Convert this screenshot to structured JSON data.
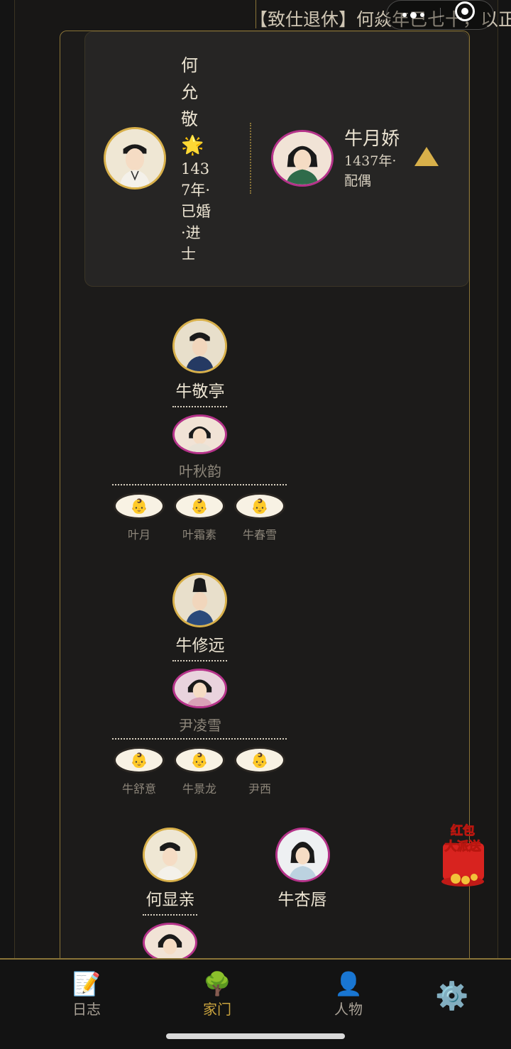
{
  "topbar": {
    "ticker_text": "【致仕退休】何焱年已七十，以正"
  },
  "head_card": {
    "name": "何允敬",
    "star_icon": "star-icon",
    "meta": "1437年·已婚·进士",
    "spouse": {
      "name": "牛月娇",
      "meta": "1437年·配偶"
    },
    "collapse_icon": "triangle-up-icon"
  },
  "branches": [
    {
      "name": "牛敬亭",
      "spouse": "叶秋韵",
      "children": [
        "叶月",
        "叶霜素",
        "牛春雪"
      ]
    },
    {
      "name": "牛修远",
      "spouse": "尹凌雪",
      "children": [
        "牛舒意",
        "牛景龙",
        "尹西"
      ]
    },
    {
      "name": "何显亲",
      "spouse": ""
    },
    {
      "name": "牛杏唇"
    }
  ],
  "child_icon": "baby-icon",
  "promo": {
    "line1": "红包",
    "line2": "大派送"
  },
  "tabbar": [
    {
      "label": "日志",
      "icon": "📝",
      "icon_name": "memo-icon",
      "active": false
    },
    {
      "label": "家门",
      "icon": "🌳",
      "icon_name": "tree-icon",
      "active": true
    },
    {
      "label": "人物",
      "icon": "👤",
      "icon_name": "person-icon",
      "active": false
    },
    {
      "label": "",
      "icon": "⚙️",
      "icon_name": "gear-icon",
      "active": false
    }
  ],
  "colors": {
    "gold": "#d8b04a",
    "female_border": "#b5338a",
    "background": "#141414"
  }
}
